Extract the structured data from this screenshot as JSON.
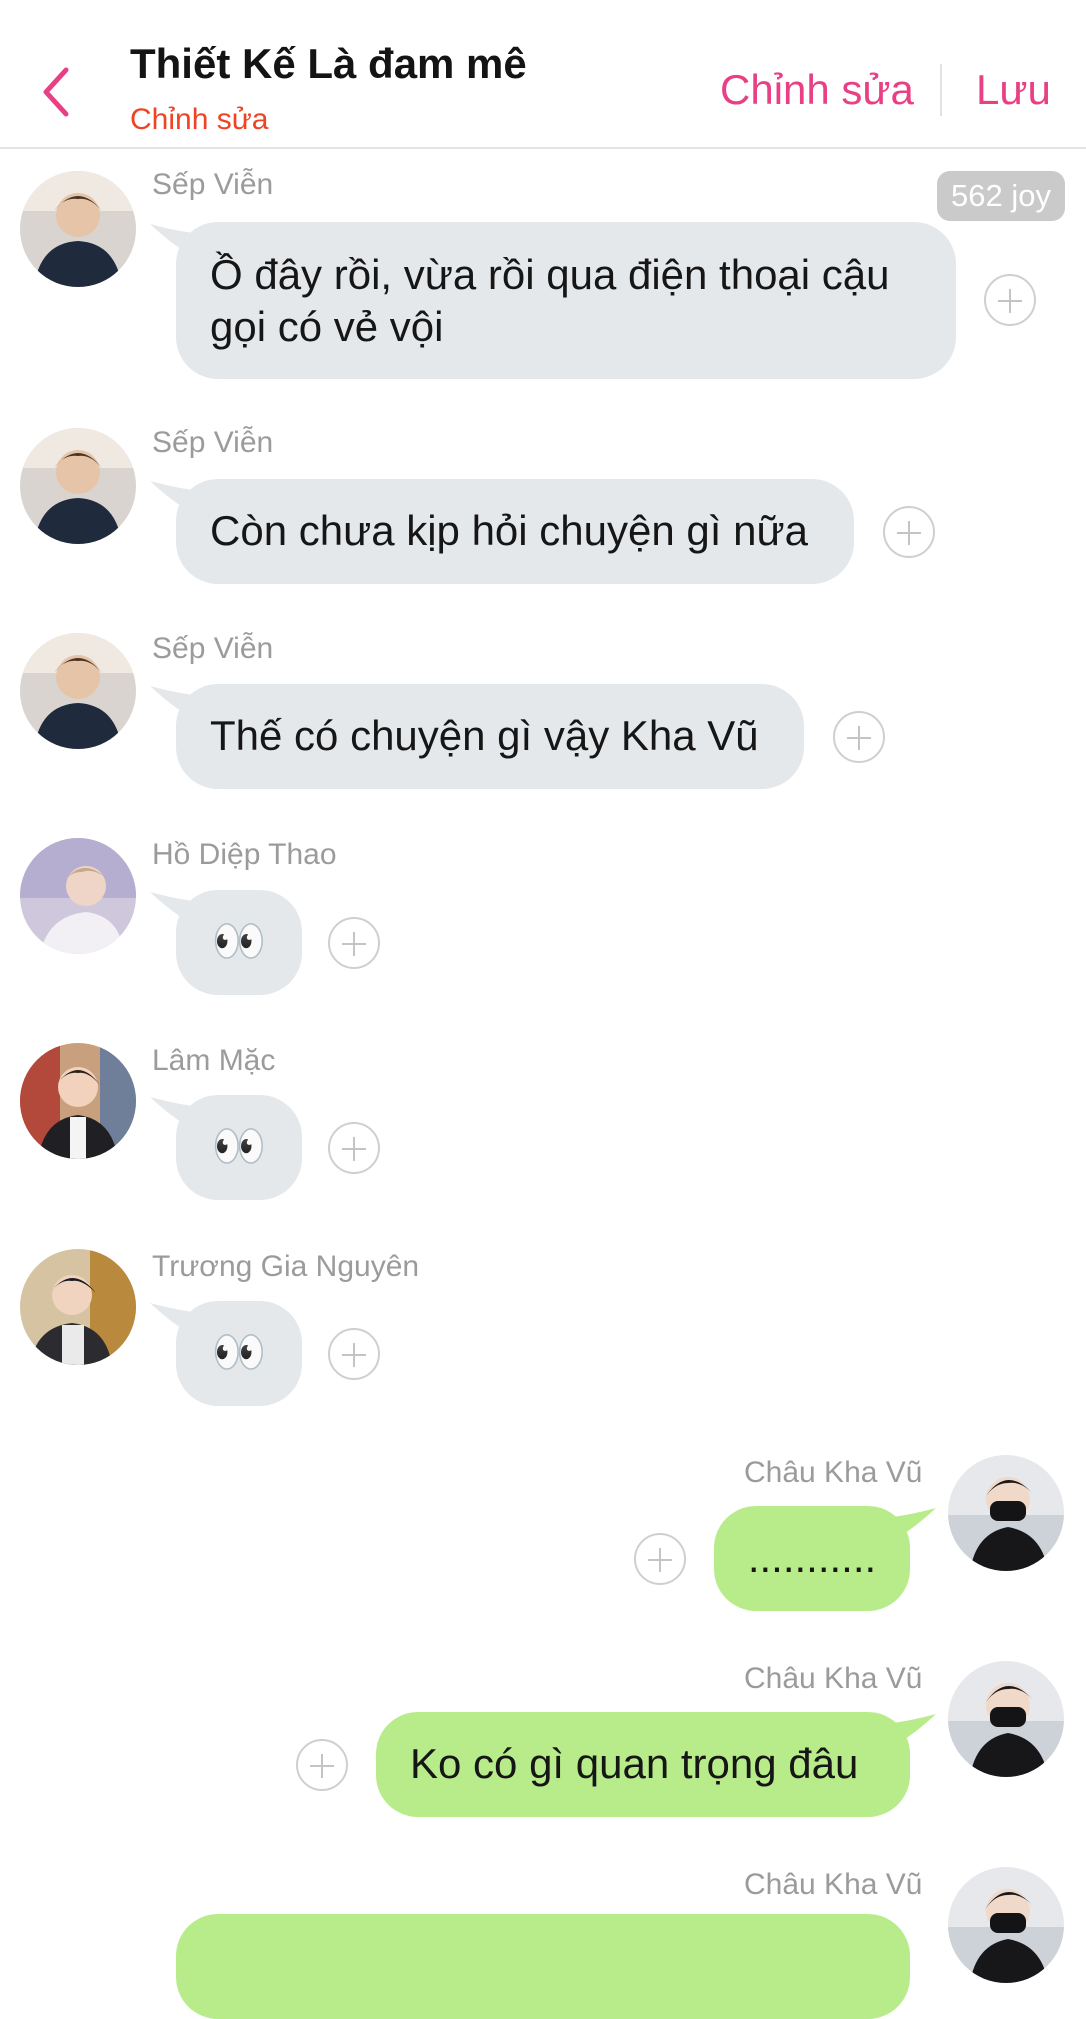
{
  "header": {
    "title": "Thiết Kế Là đam mê",
    "subtitle": "Chỉnh sửa",
    "edit_label": "Chỉnh sửa",
    "save_label": "Lưu",
    "back_icon": "chevron-left-icon"
  },
  "badge": {
    "text": "562 joy"
  },
  "colors": {
    "accent": "#e93f85",
    "subtitle": "#ef4323",
    "incoming_bubble": "#e5e8eb",
    "outgoing_bubble": "#b8ec8b",
    "sender_name": "#9b9b9b"
  },
  "messages": [
    {
      "sender": "Sếp Viễn",
      "direction": "in",
      "text": "Ồ đây rồi, vừa rồi qua điện thoại cậu gọi có vẻ vội"
    },
    {
      "sender": "Sếp Viễn",
      "direction": "in",
      "text": "Còn chưa kịp hỏi chuyện gì nữa"
    },
    {
      "sender": "Sếp Viễn",
      "direction": "in",
      "text": "Thế có chuyện gì vậy Kha Vũ"
    },
    {
      "sender": "Hồ Diệp Thao",
      "direction": "in",
      "text": "👀"
    },
    {
      "sender": "Lâm Mặc",
      "direction": "in",
      "text": "👀"
    },
    {
      "sender": "Trương Gia Nguyên",
      "direction": "in",
      "text": "👀"
    },
    {
      "sender": "Châu Kha Vũ",
      "direction": "out",
      "text": "..........."
    },
    {
      "sender": "Châu Kha Vũ",
      "direction": "out",
      "text": "Ko có gì quan trọng đâu"
    },
    {
      "sender": "Châu Kha Vũ",
      "direction": "out",
      "text": ""
    }
  ]
}
